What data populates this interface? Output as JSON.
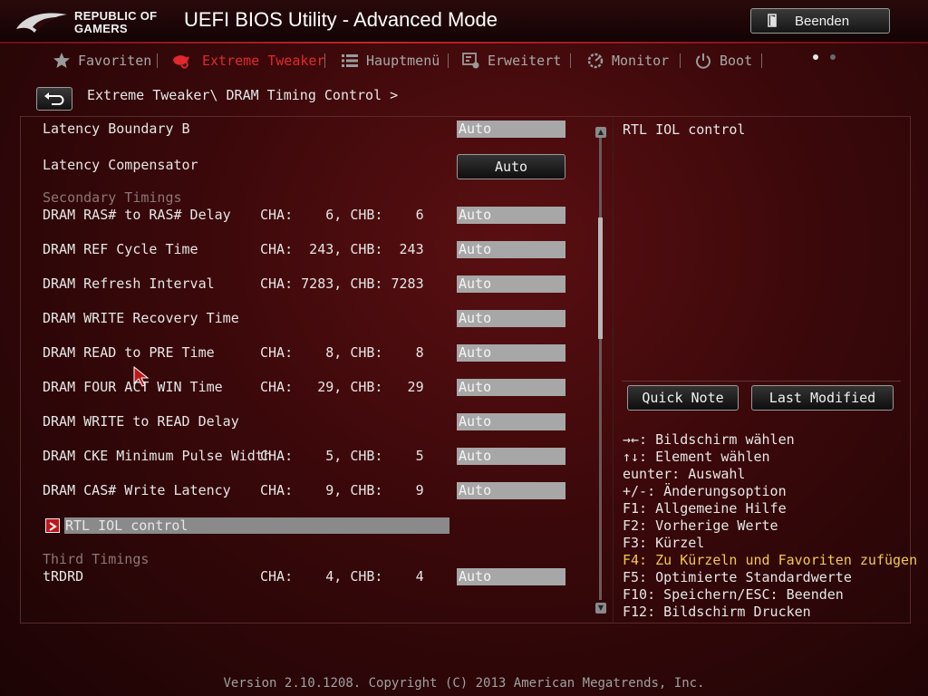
{
  "header": {
    "logo_line1": "REPUBLIC OF",
    "logo_line2": "GAMERS",
    "title": "UEFI BIOS Utility - Advanced Mode",
    "exit_label": "Beenden"
  },
  "nav": {
    "items": [
      {
        "label": "Favoriten",
        "icon": "star-icon",
        "active": false
      },
      {
        "label": "Extreme Tweaker",
        "icon": "tweaker-icon",
        "active": true
      },
      {
        "label": "Hauptmenü",
        "icon": "list-icon",
        "active": false
      },
      {
        "label": "Erweitert",
        "icon": "advanced-icon",
        "active": false
      },
      {
        "label": "Monitor",
        "icon": "monitor-icon",
        "active": false
      },
      {
        "label": "Boot",
        "icon": "power-icon",
        "active": false
      }
    ]
  },
  "breadcrumb": "Extreme Tweaker\\ DRAM Timing Control >",
  "settings": [
    {
      "label": "Latency Boundary B",
      "cha": "",
      "value": "Auto"
    },
    {
      "label": "Latency Compensator",
      "button": "Auto"
    },
    {
      "section": "Secondary Timings"
    },
    {
      "label": "DRAM RAS# to RAS# Delay",
      "cha": "CHA:    6, CHB:    6",
      "value": "Auto"
    },
    {
      "label": "DRAM REF Cycle Time",
      "cha": "CHA:  243, CHB:  243",
      "value": "Auto"
    },
    {
      "label": "DRAM Refresh Interval",
      "cha": "CHA: 7283, CHB: 7283",
      "value": "Auto"
    },
    {
      "label": "DRAM WRITE Recovery Time",
      "cha": "",
      "value": "Auto"
    },
    {
      "label": "DRAM READ to PRE Time",
      "cha": "CHA:    8, CHB:    8",
      "value": "Auto"
    },
    {
      "label": "DRAM FOUR ACT WIN Time",
      "cha": "CHA:   29, CHB:   29",
      "value": "Auto"
    },
    {
      "label": "DRAM WRITE to READ Delay",
      "cha": "",
      "value": "Auto"
    },
    {
      "label": "DRAM CKE Minimum Pulse Width",
      "cha": "CHA:    5, CHB:    5",
      "value": "Auto"
    },
    {
      "label": "DRAM CAS# Write Latency",
      "cha": "CHA:    9, CHB:    9",
      "value": "Auto"
    },
    {
      "label": "RTL IOL control",
      "submenu": true
    },
    {
      "section": "Third Timings"
    },
    {
      "label": "tRDRD",
      "cha": "CHA:    4, CHB:    4",
      "value": "Auto"
    }
  ],
  "help": {
    "title": "RTL IOL control",
    "quick_note": "Quick Note",
    "last_modified": "Last Modified",
    "keys": [
      "→←: Bildschirm wählen",
      "↑↓: Element wählen",
      "eunter: Auswahl",
      "+/-: Änderungsoption",
      "F1: Allgemeine Hilfe",
      "F2: Vorherige Werte",
      "F3: Kürzel",
      "F4: Zu Kürzeln und Favoriten zufügen",
      "F5: Optimierte Standardwerte",
      "F10: Speichern/ESC: Beenden",
      "F12: Bildschirm Drucken"
    ]
  },
  "footer": "Version 2.10.1208. Copyright (C) 2013 American Megatrends, Inc.",
  "colors": {
    "accent": "#e0282e",
    "highlight": "#f2c94c"
  }
}
